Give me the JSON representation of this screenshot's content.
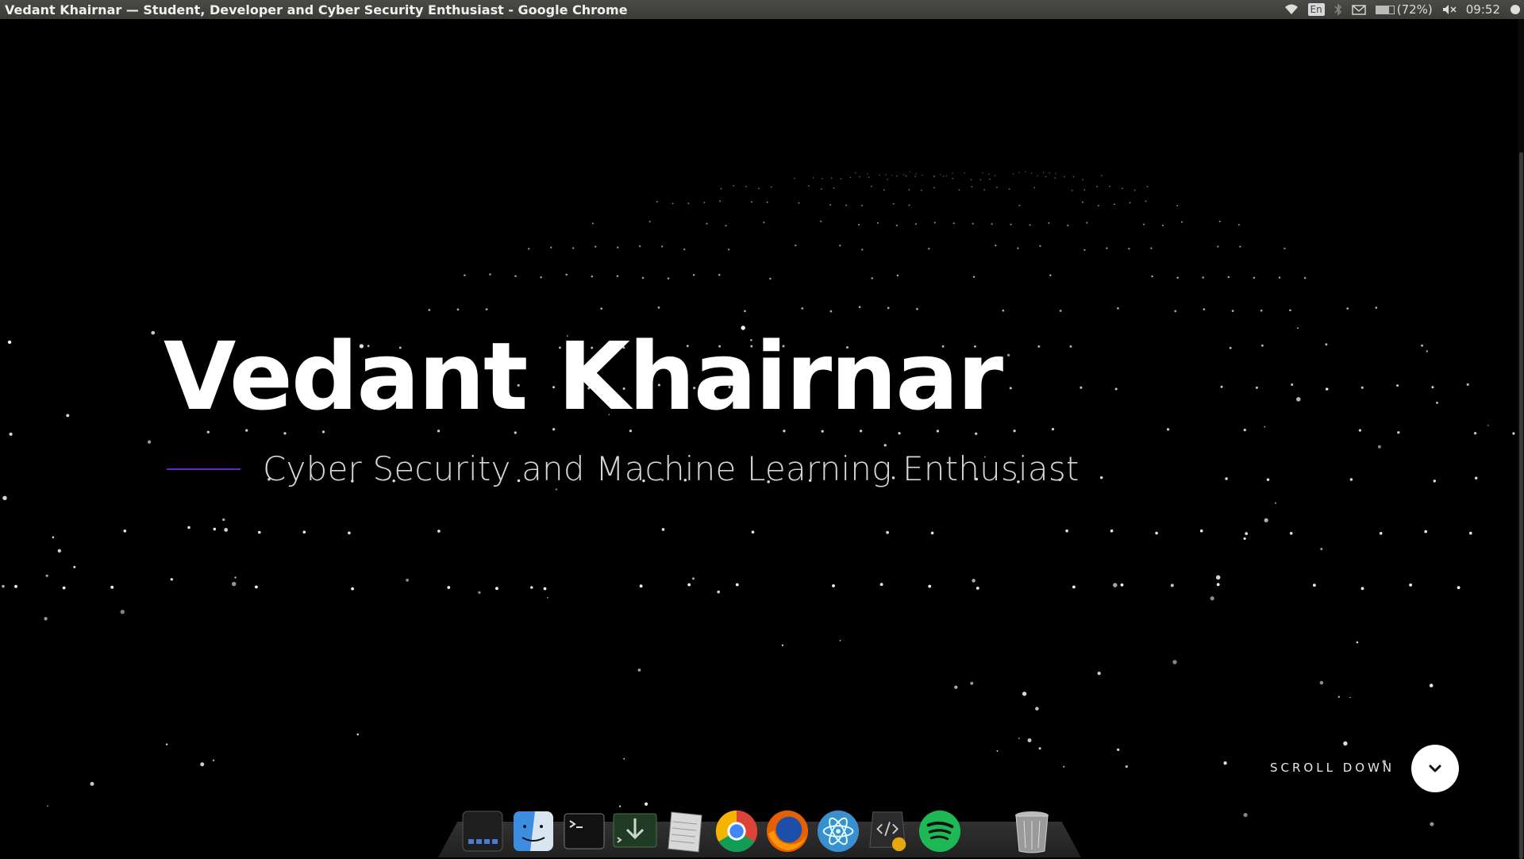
{
  "window": {
    "title": "Vedant Khairnar — Student, Developer and Cyber Security Enthusiast - Google Chrome"
  },
  "tray": {
    "wifi_icon": "wifi-icon",
    "keyboard_layout": "En",
    "bluetooth_icon": "bluetooth-icon",
    "mail_icon": "mail-icon",
    "battery_percent": "(72%)",
    "battery_level": 0.72,
    "volume_icon": "volume-muted-icon",
    "time": "09:52",
    "power_icon": "power-icon"
  },
  "hero": {
    "name": "Vedant Khairnar",
    "tagline": "Cyber Security and Machine Learning Enthusiast",
    "accent_color": "#6a1fd8"
  },
  "scroll": {
    "label": "SCROLL DOWN",
    "icon": "chevron-down-icon"
  },
  "dock": {
    "apps": [
      {
        "name": "workspace-switcher",
        "icon": "workspaces-icon"
      },
      {
        "name": "finder",
        "icon": "finder-icon"
      },
      {
        "name": "terminal",
        "icon": "terminal-icon"
      },
      {
        "name": "installer",
        "icon": "download-terminal-icon"
      },
      {
        "name": "text-editor",
        "icon": "notes-icon"
      },
      {
        "name": "google-chrome",
        "icon": "chrome-icon"
      },
      {
        "name": "firefox",
        "icon": "firefox-icon"
      },
      {
        "name": "atom",
        "icon": "atom-icon"
      },
      {
        "name": "code-tool",
        "icon": "code-icon"
      },
      {
        "name": "spotify",
        "icon": "spotify-icon"
      },
      {
        "name": "trash",
        "icon": "trash-icon"
      }
    ]
  }
}
